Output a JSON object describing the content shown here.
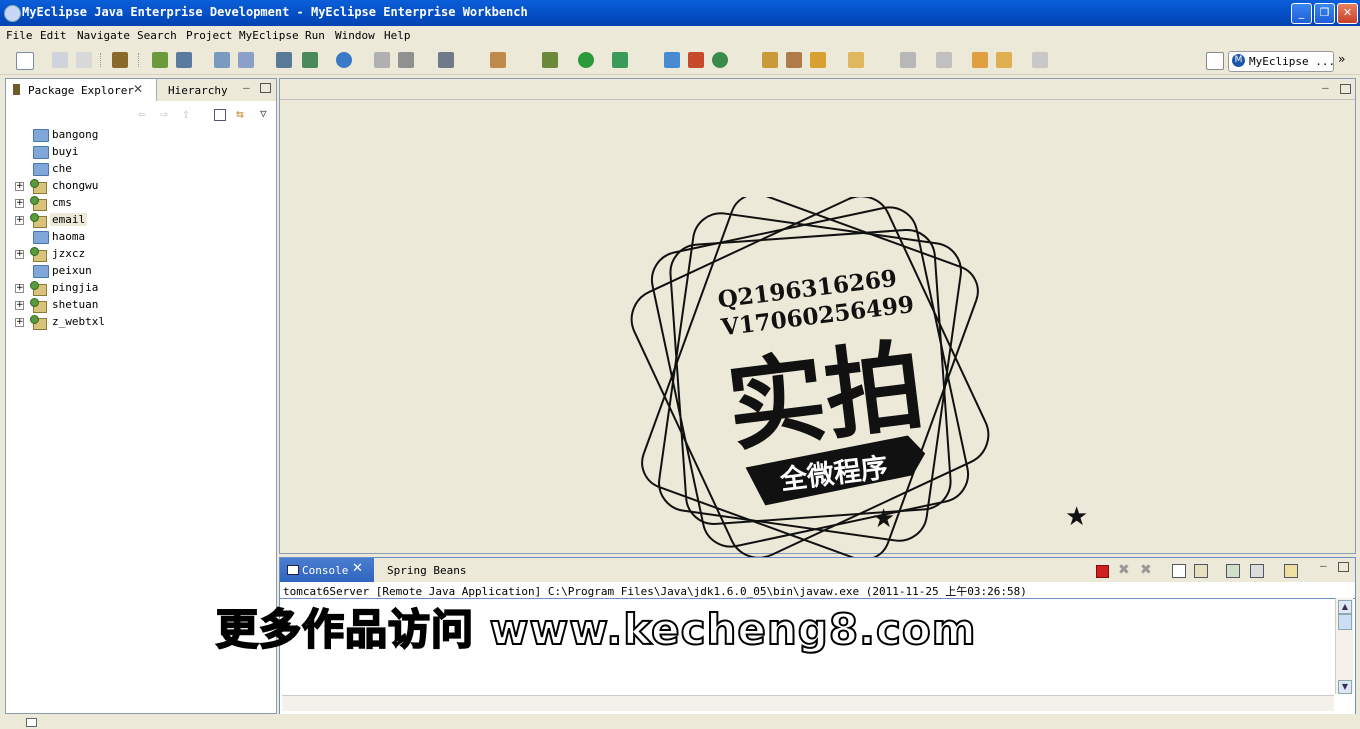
{
  "window": {
    "title": "MyEclipse Java Enterprise Development - MyEclipse Enterprise Workbench",
    "minimize_label": "_",
    "restore_label": "❐",
    "close_label": "✕"
  },
  "menubar": [
    "File",
    "Edit",
    "Navigate",
    "Search",
    "Project",
    "MyEclipse",
    "Run",
    "Window",
    "Help"
  ],
  "toolbar": {
    "perspective_label": "MyEclipse ...",
    "perspective_more": "»"
  },
  "package_explorer": {
    "tab_label": "Package Explorer",
    "tab2_label": "Hierarchy",
    "items": [
      {
        "label": "bangong",
        "type": "folder",
        "expandable": false
      },
      {
        "label": "buyi",
        "type": "folder",
        "expandable": false
      },
      {
        "label": "che",
        "type": "folder",
        "expandable": false
      },
      {
        "label": "chongwu",
        "type": "project",
        "expandable": true
      },
      {
        "label": "cms",
        "type": "project",
        "expandable": true
      },
      {
        "label": "email",
        "type": "project",
        "expandable": true,
        "selected": true
      },
      {
        "label": "haoma",
        "type": "folder",
        "expandable": false
      },
      {
        "label": "jzxcz",
        "type": "project",
        "expandable": true
      },
      {
        "label": "peixun",
        "type": "folder",
        "expandable": false
      },
      {
        "label": "pingjia",
        "type": "project",
        "expandable": true
      },
      {
        "label": "shetuan",
        "type": "project",
        "expandable": true
      },
      {
        "label": "z_webtxl",
        "type": "project",
        "expandable": true
      }
    ]
  },
  "stamp": {
    "line1": "Q2196316269",
    "line2": "V17060256499",
    "main": "实拍",
    "ribbon": "全微程序"
  },
  "console": {
    "tab_label": "Console",
    "tab2_label": "Spring Beans",
    "header": "tomcat6Server [Remote Java Application] C:\\Program Files\\Java\\jdk1.6.0_05\\bin\\javaw.exe (2011-11-25 上午03:26:58)"
  },
  "watermark": "更多作品访问 www.kecheng8.com",
  "colors": {
    "title_bar": "#0550c8",
    "chrome": "#ece9d8",
    "console_tab": "#2f64c0"
  }
}
